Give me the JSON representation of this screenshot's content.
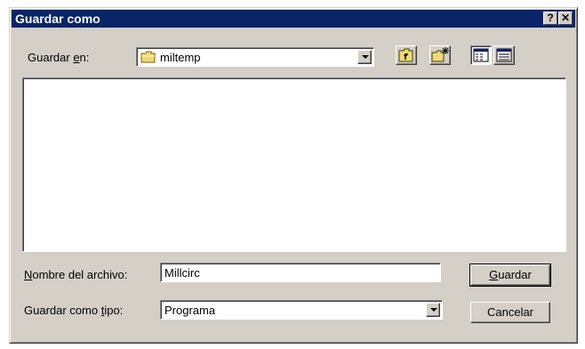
{
  "window": {
    "title": "Guardar como",
    "help_label": "?",
    "close_label": "✕"
  },
  "save_in": {
    "label_prefix": "Guardar ",
    "label_hotkey": "e",
    "label_suffix": "n:",
    "value": "miltemp"
  },
  "toolbar": {
    "icons": [
      "folder-up-icon",
      "new-folder-icon",
      "list-view-icon",
      "details-view-icon"
    ]
  },
  "filename": {
    "label_hotkey": "N",
    "label_rest": "ombre del archivo:",
    "value": "Millcirc"
  },
  "filetype": {
    "label_prefix": "Guardar como ",
    "label_hotkey": "t",
    "label_suffix": "ipo:",
    "value": "Programa"
  },
  "buttons": {
    "save_hotkey": "G",
    "save_rest": "uardar",
    "cancel": "Cancelar"
  },
  "colors": {
    "titlebar": "#0a246a",
    "face": "#d4d0c8",
    "folder": "#f0d878"
  }
}
